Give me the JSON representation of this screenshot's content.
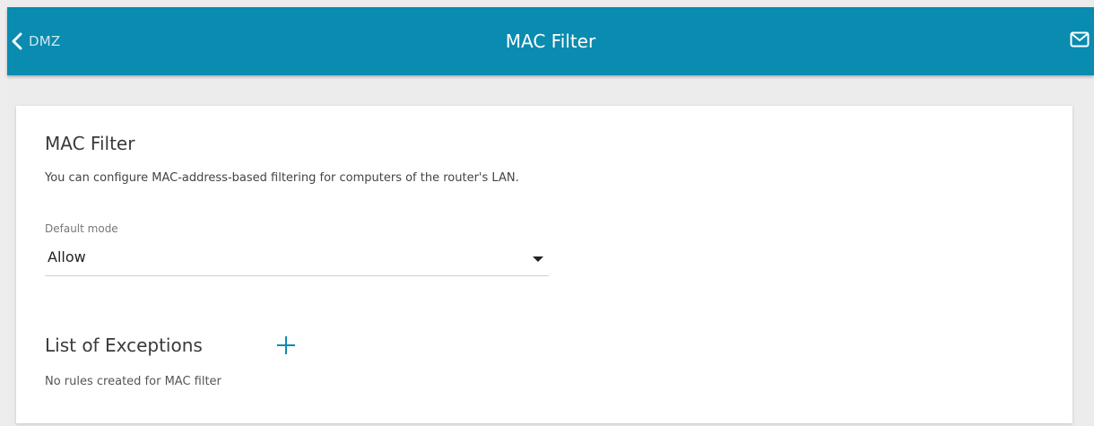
{
  "header": {
    "back_label": "DMZ",
    "title": "MAC Filter",
    "back_icon": "chevron-left-icon",
    "mail_icon": "mail-icon",
    "bar_color": "#0a8bb0"
  },
  "card": {
    "title": "MAC Filter",
    "description": "You can configure MAC-address-based filtering for computers of the router's LAN.",
    "default_mode": {
      "label": "Default mode",
      "value": "Allow"
    },
    "exceptions": {
      "title": "List of Exceptions",
      "add_icon": "plus-icon",
      "empty_text": "No rules created for MAC filter"
    }
  }
}
